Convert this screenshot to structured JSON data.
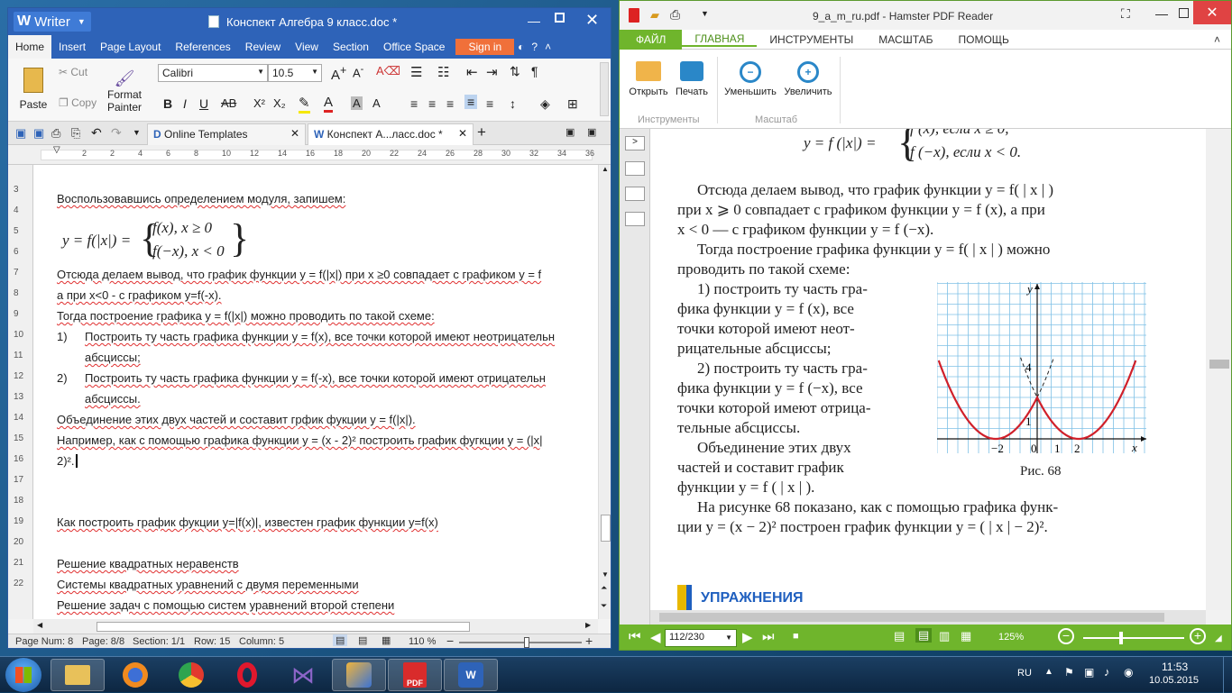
{
  "writer": {
    "app_name": "Writer",
    "doc_title": "Конспект Алгебра 9 класс.doc *",
    "menu": [
      "Home",
      "Insert",
      "Page Layout",
      "References",
      "Review",
      "View",
      "Section",
      "Office Space"
    ],
    "signin": "Sign in",
    "ribbon": {
      "paste": "Paste",
      "cut": "Cut",
      "copy": "Copy",
      "format_painter_1": "Format",
      "format_painter_2": "Painter",
      "font_name": "Calibri",
      "font_size": "10.5"
    },
    "tabs": {
      "templates": "Online Templates",
      "doc": "Конспект А...ласс.doc *"
    },
    "ruler_marks": [
      "2",
      "2",
      "4",
      "6",
      "8",
      "10",
      "12",
      "14",
      "16",
      "18",
      "20",
      "22",
      "24",
      "26",
      "28",
      "30",
      "32",
      "34",
      "36",
      "38"
    ],
    "line_numbers": [
      "3",
      "4",
      "5",
      "6",
      "7",
      "8",
      "9",
      "10",
      "11",
      "12",
      "13",
      "14",
      "15",
      "16",
      "17",
      "18",
      "19",
      "20",
      "21",
      "22"
    ],
    "content": {
      "l1": "Воспользовавшись определением модуля, запишем:",
      "f_y": "y = f(|x|) =",
      "f_c1": "f(x), x ≥ 0",
      "f_c2": "f(−x), x < 0",
      "l2": "Отсюда делаем вывод, что график функции y = f(|x|) при x ≥0 совпадает с графиком y = f",
      "l3": "а при x<0 - с графиком y=f(-x).",
      "l4": "Тогда построение графика y = f(|x|) можно проводить по такой схеме:",
      "n1": "1)",
      "l5": "Построить ту часть графика функции y = f(x), все точки которой имеют неотрицательн",
      "l5b": "абсциссы;",
      "n2": "2)",
      "l6": "Построить ту часть графика функции y = f(-x), все точки которой имеют отрицательн",
      "l6b": "абсциссы.",
      "l7": "Объединение этих двух частей и составит грфик фукции y = f(|x|).",
      "l8": "Например, как с помощью графика функции y = (x - 2)² построить график фугкции y = (|x|",
      "l8b": "2)².",
      "l9": "Как построить график фукции y=|f(x)|, известен график функции y=f(x)",
      "l10": "Решение квадратных неравенств",
      "l11": "Системы квадратных уравнений с двумя переменными",
      "l12": "Решение задач с помощью систем уравнений второй степени"
    },
    "status": {
      "page_num": "Page Num: 8",
      "page": "Page: 8/8",
      "section": "Section: 1/1",
      "row": "Row: 15",
      "column": "Column: 5",
      "zoom": "110 %",
      "zoom_level_fraction": 0.55
    }
  },
  "pdf": {
    "title": "9_a_m_ru.pdf - Hamster PDF Reader",
    "menu": [
      "ФАЙЛ",
      "ГЛАВНАЯ",
      "ИНСТРУМЕНТЫ",
      "МАСШТАБ",
      "ПОМОЩЬ"
    ],
    "ribbon": {
      "open": "Открыть",
      "print": "Печать",
      "zoom_out": "Уменьшить",
      "zoom_in": "Увеличить",
      "group1": "Инструменты",
      "group2": "Масштаб"
    },
    "page_text": {
      "top_formula": "y = f (|x|) =",
      "top_c1": "f (x),  если x ≥ 0,",
      "top_c2": "f (−x), если x < 0.",
      "p1a": "Отсюда делаем вывод, что график функции y = f( | x | )",
      "p1b": "при x ⩾ 0 совпадает с графиком функции y = f (x), а при",
      "p1c": "x < 0 — с графиком функции y = f (−x).",
      "p2a": "Тогда построение графика функции y = f( | x | ) можно",
      "p2b": "проводить по такой схеме:",
      "s1a": "1) построить ту часть гра-",
      "s1b": "фика функции y = f (x), все",
      "s1c": "точки которой имеют неот-",
      "s1d": "рицательные абсциссы;",
      "s2a": "2) построить ту часть гра-",
      "s2b": "фика функции y = f (−x), все",
      "s2c": "точки которой имеют отрица-",
      "s2d": "тельные абсциссы.",
      "s3a": "Объединение этих двух",
      "s3b": "частей и составит график",
      "s3c": "функции y = f ( | x | ).",
      "p3a": "На рисунке 68 показано, как с помощью графика функ-",
      "p3b": "ции y = (x − 2)² построен график функции y = ( | x | − 2)².",
      "fig_caption": "Рис. 68",
      "exercises": "УПРАЖНЕНИЯ"
    },
    "figure": {
      "y_label": "y",
      "x_label": "x",
      "tick_4": "4",
      "tick_1y": "1",
      "tick_m2": "−2",
      "tick_0": "0",
      "tick_1x": "1",
      "tick_2": "2",
      "curve_color": "#d0202a"
    },
    "bottom": {
      "page_field": "112/230",
      "zoom": "125%"
    }
  },
  "taskbar": {
    "lang": "RU",
    "time": "11:53",
    "date": "10.05.2015",
    "apps": [
      "file-explorer-icon",
      "firefox-icon",
      "chrome-icon",
      "opera-icon",
      "visual-studio-icon",
      "tool-icon",
      "pdf-reader-icon",
      "writer-icon"
    ]
  }
}
